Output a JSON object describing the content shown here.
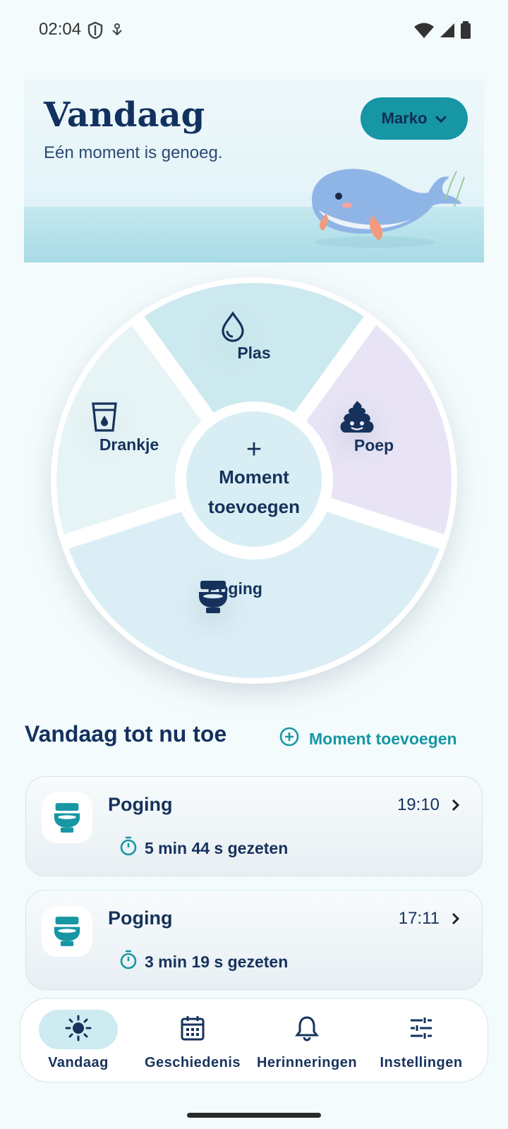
{
  "status_bar": {
    "time": "02:04",
    "icons": [
      "shield-icon",
      "download-icon",
      "wifi-icon",
      "signal-icon",
      "battery-icon"
    ]
  },
  "hero": {
    "title": "Vandaag",
    "subtitle": "Eén moment is genoeg.",
    "user_chip": {
      "label": "Marko",
      "icon": "chevron-down-icon"
    }
  },
  "wheel": {
    "segments": [
      {
        "label": "Plas",
        "icon": "droplet-icon",
        "color": "#cce9ef"
      },
      {
        "label": "Poep",
        "icon": "poop-icon",
        "color": "#e8e4f6"
      },
      {
        "label": "Poging",
        "icon": "toilet-icon",
        "color": "#dbeef6"
      },
      {
        "label": "Drankje",
        "icon": "cup-icon",
        "color": "#e6f4f6"
      }
    ],
    "center": {
      "plus": "+",
      "line1": "Moment",
      "line2": "toevoegen"
    }
  },
  "section": {
    "title": "Vandaag tot nu toe",
    "add_link": "Moment toevoegen"
  },
  "entries": [
    {
      "title": "Poging",
      "time": "19:10",
      "duration": "5 min 44 s gezeten"
    },
    {
      "title": "Poging",
      "time": "17:11",
      "duration": "3 min 19 s gezeten"
    }
  ],
  "bottom_nav": [
    {
      "label": "Vandaag",
      "icon": "sun-icon",
      "active": true
    },
    {
      "label": "Geschiedenis",
      "icon": "calendar-icon",
      "active": false
    },
    {
      "label": "Herinneringen",
      "icon": "bell-icon",
      "active": false
    },
    {
      "label": "Instellingen",
      "icon": "sliders-icon",
      "active": false
    }
  ],
  "colors": {
    "accent": "#1796a4",
    "text_primary": "#16325c",
    "background": "#f4fbfc"
  }
}
